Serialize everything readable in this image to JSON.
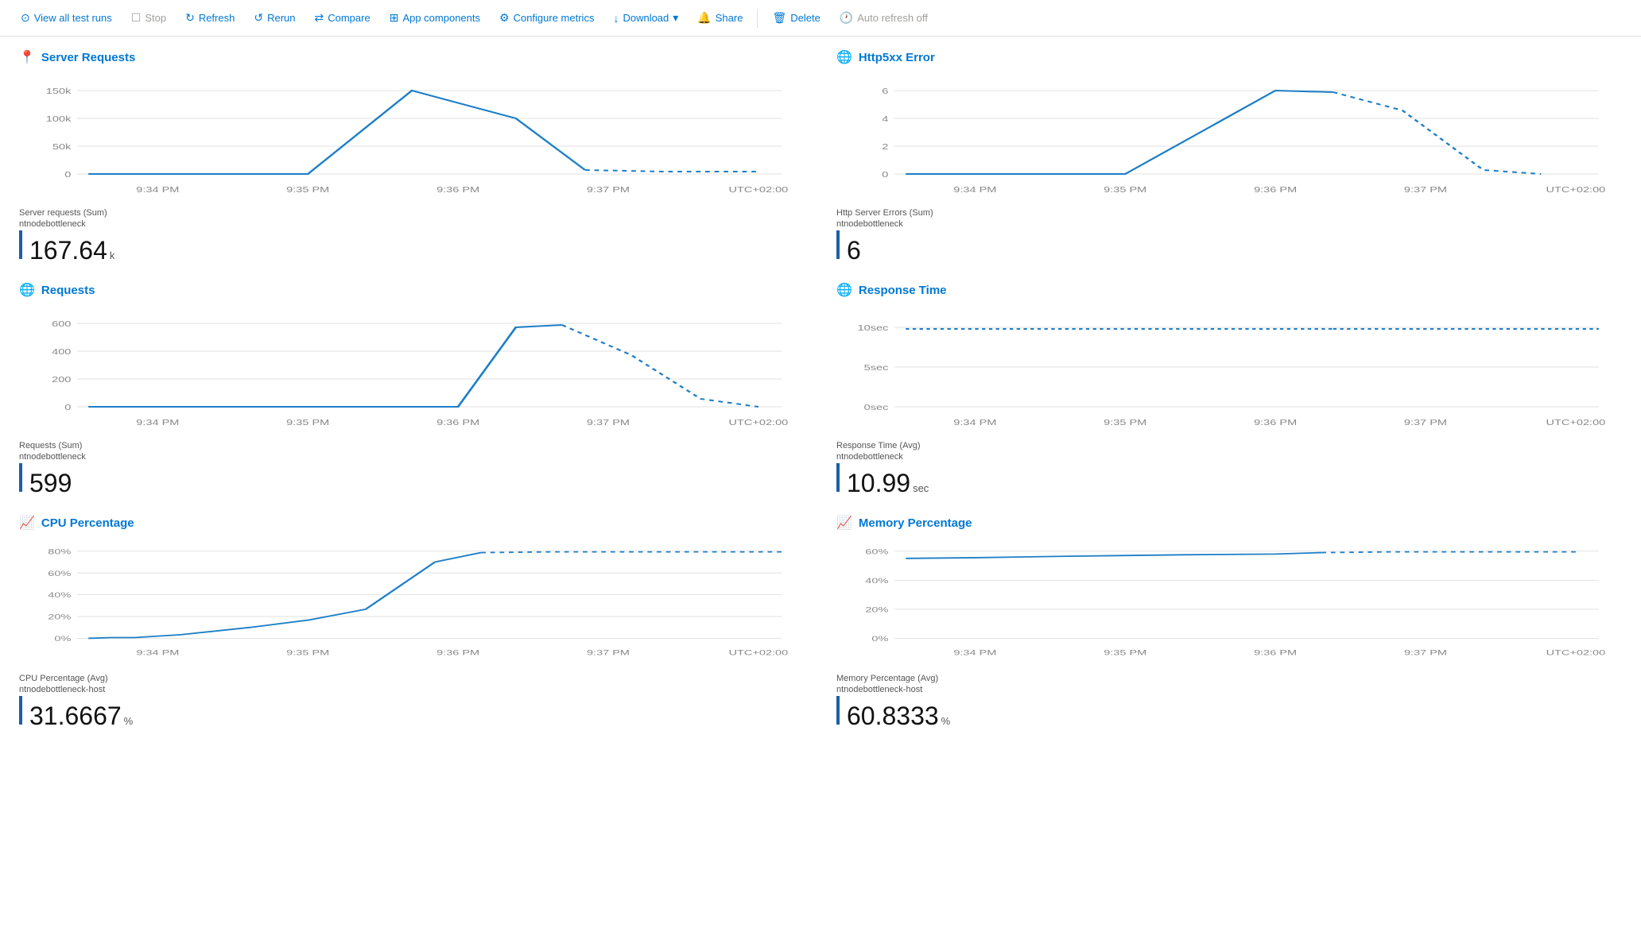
{
  "toolbar": {
    "view_all_label": "View all test runs",
    "stop_label": "Stop",
    "refresh_label": "Refresh",
    "rerun_label": "Rerun",
    "compare_label": "Compare",
    "app_components_label": "App components",
    "configure_metrics_label": "Configure metrics",
    "download_label": "Download",
    "share_label": "Share",
    "delete_label": "Delete",
    "auto_refresh_label": "Auto refresh off"
  },
  "charts": [
    {
      "id": "server-requests",
      "title": "Server Requests",
      "icon": "📍",
      "legend_label": "Server requests (Sum)",
      "legend_sublabel": "ntnodebottleneck",
      "value": "167.64",
      "unit": "k",
      "y_labels": [
        "150k",
        "100k",
        "50k",
        "0"
      ],
      "x_labels": [
        "9:34 PM",
        "9:35 PM",
        "9:36 PM",
        "9:37 PM",
        "UTC+02:00"
      ],
      "color": "#1c7ec7"
    },
    {
      "id": "http5xx-error",
      "title": "Http5xx Error",
      "icon": "🌐",
      "legend_label": "Http Server Errors (Sum)",
      "legend_sublabel": "ntnodebottleneck",
      "value": "6",
      "unit": "",
      "y_labels": [
        "6",
        "4",
        "2",
        "0"
      ],
      "x_labels": [
        "9:34 PM",
        "9:35 PM",
        "9:36 PM",
        "9:37 PM",
        "UTC+02:00"
      ],
      "color": "#1c7ec7"
    },
    {
      "id": "requests",
      "title": "Requests",
      "icon": "🌐",
      "legend_label": "Requests (Sum)",
      "legend_sublabel": "ntnodebottleneck",
      "value": "599",
      "unit": "",
      "y_labels": [
        "600",
        "400",
        "200",
        "0"
      ],
      "x_labels": [
        "9:34 PM",
        "9:35 PM",
        "9:36 PM",
        "9:37 PM",
        "UTC+02:00"
      ],
      "color": "#1c7ec7"
    },
    {
      "id": "response-time",
      "title": "Response Time",
      "icon": "🌐",
      "legend_label": "Response Time (Avg)",
      "legend_sublabel": "ntnodebottleneck",
      "value": "10.99",
      "unit": " sec",
      "y_labels": [
        "10sec",
        "5sec",
        "0sec"
      ],
      "x_labels": [
        "9:34 PM",
        "9:35 PM",
        "9:36 PM",
        "9:37 PM",
        "UTC+02:00"
      ],
      "color": "#1c7ec7"
    },
    {
      "id": "cpu-percentage",
      "title": "CPU Percentage",
      "icon": "📊",
      "legend_label": "CPU Percentage (Avg)",
      "legend_sublabel": "ntnodebottleneck-host",
      "value": "31.6667",
      "unit": " %",
      "y_labels": [
        "80%",
        "60%",
        "40%",
        "20%",
        "0%"
      ],
      "x_labels": [
        "9:34 PM",
        "9:35 PM",
        "9:36 PM",
        "9:37 PM",
        "UTC+02:00"
      ],
      "color": "#1c7ec7"
    },
    {
      "id": "memory-percentage",
      "title": "Memory Percentage",
      "icon": "📊",
      "legend_label": "Memory Percentage (Avg)",
      "legend_sublabel": "ntnodebottleneck-host",
      "value": "60.8333",
      "unit": " %",
      "y_labels": [
        "60%",
        "40%",
        "20%",
        "0%"
      ],
      "x_labels": [
        "9:34 PM",
        "9:35 PM",
        "9:36 PM",
        "9:37 PM",
        "UTC+02:00"
      ],
      "color": "#1c7ec7"
    }
  ]
}
